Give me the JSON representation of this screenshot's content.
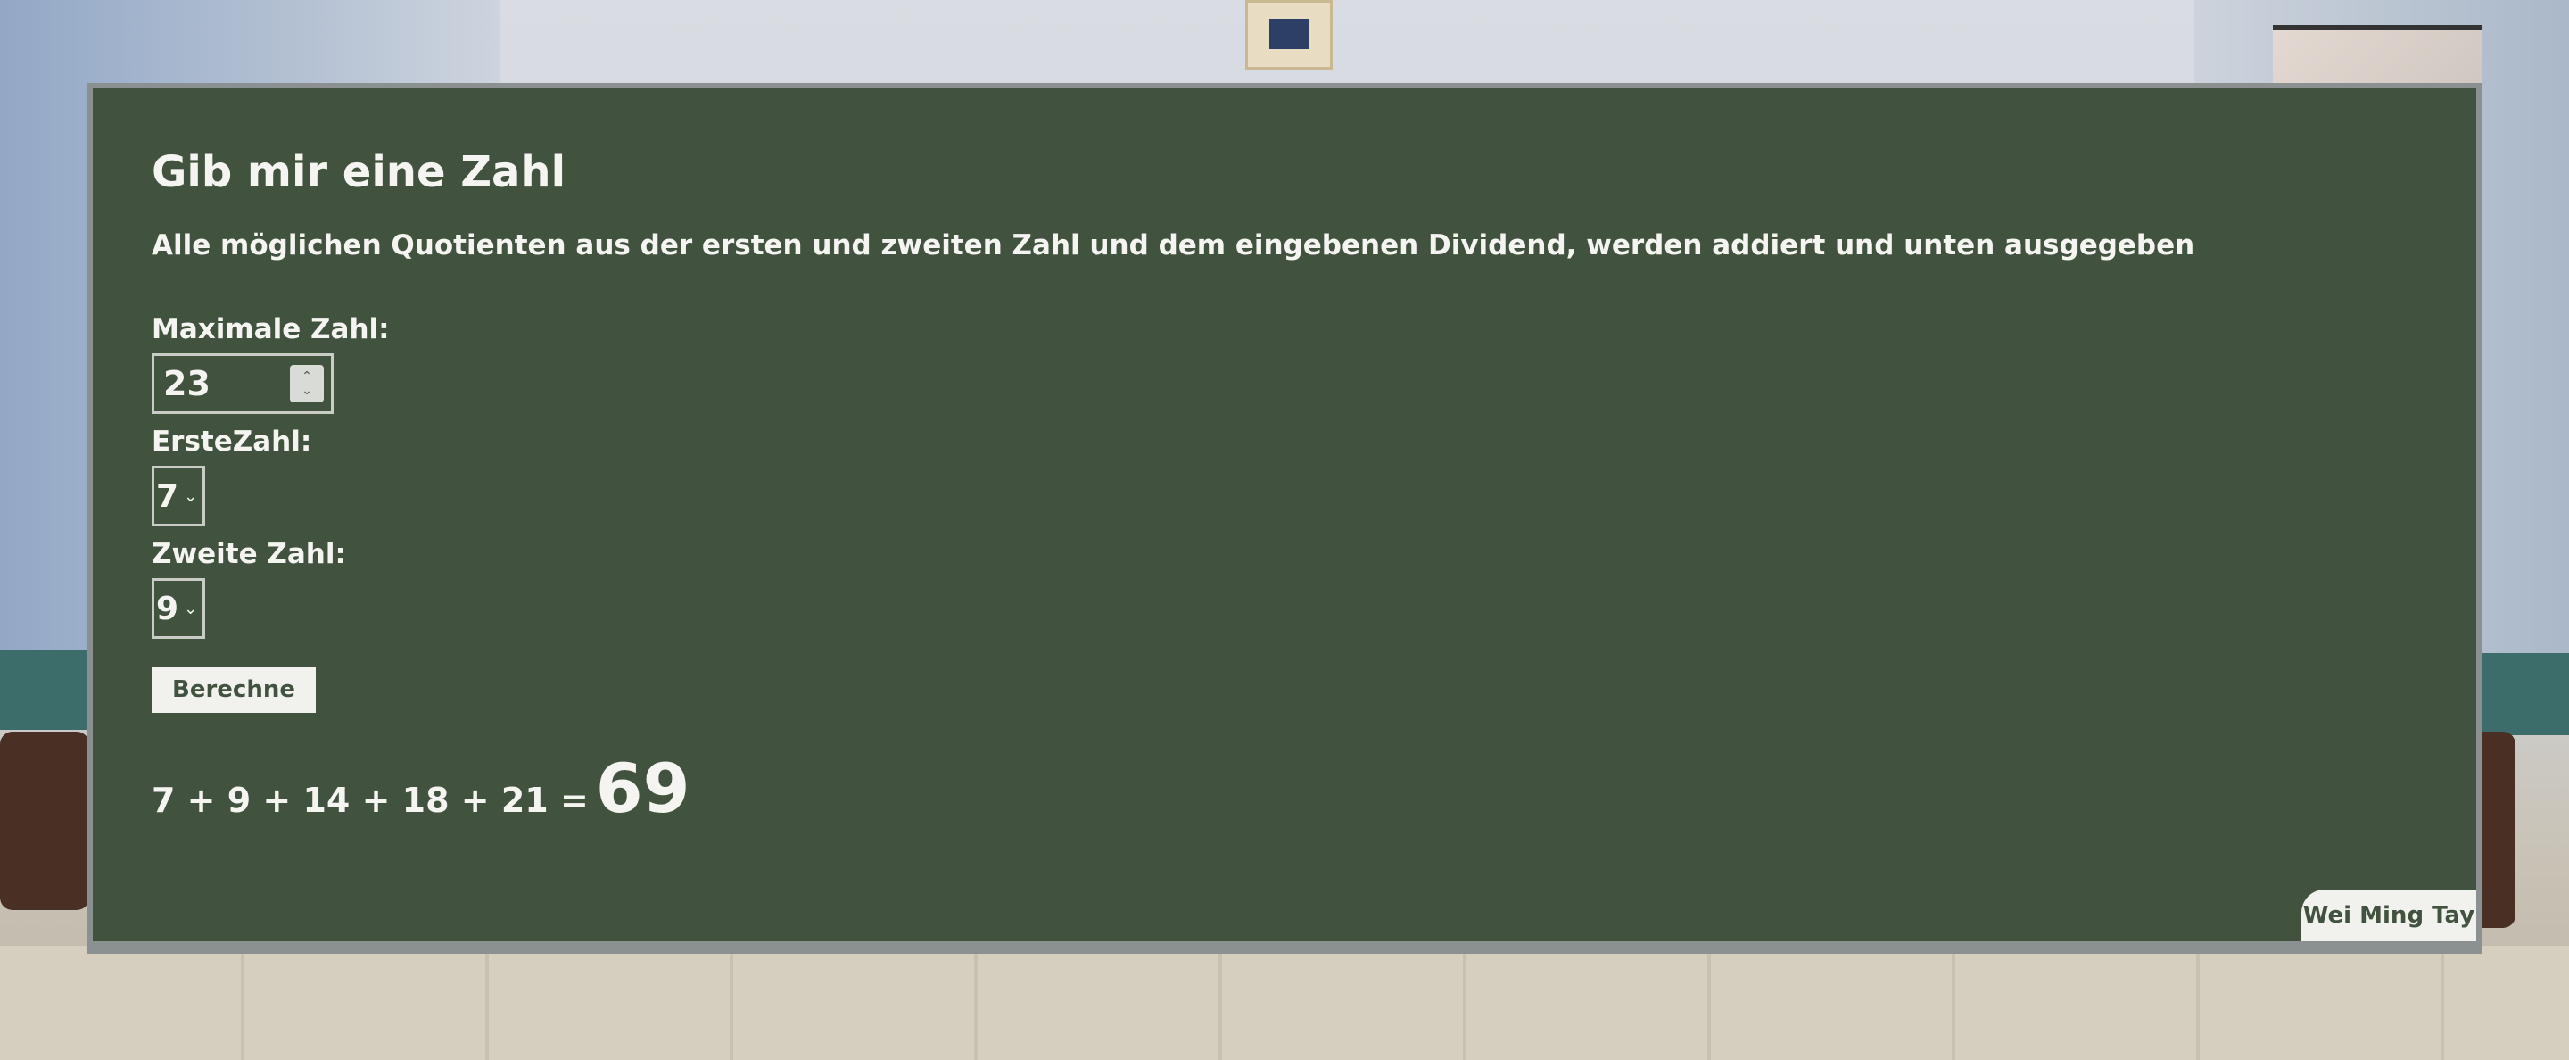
{
  "page": {
    "title": "Gib mir eine Zahl",
    "description": "Alle möglichen Quotienten aus der ersten und zweiten Zahl und dem eingebenen Dividend, werden addiert und unten ausgegeben"
  },
  "form": {
    "max_label": "Maximale Zahl:",
    "max_value": "23",
    "first_label": "ErsteZahl:",
    "first_value": "7",
    "second_label": "Zweite Zahl:",
    "second_value": "9",
    "submit_label": "Berechne"
  },
  "result": {
    "expression": "7 + 9 + 14 + 18 + 21 =",
    "sum": "69"
  },
  "footer": {
    "author": "Wei Ming Tay"
  },
  "colors": {
    "board": "#41523f",
    "chalk": "#f4f4f0",
    "frame": "#8b9190"
  },
  "icons": {
    "stepper": "up-down-chevron-icon",
    "dropdown": "chevron-down-icon"
  }
}
